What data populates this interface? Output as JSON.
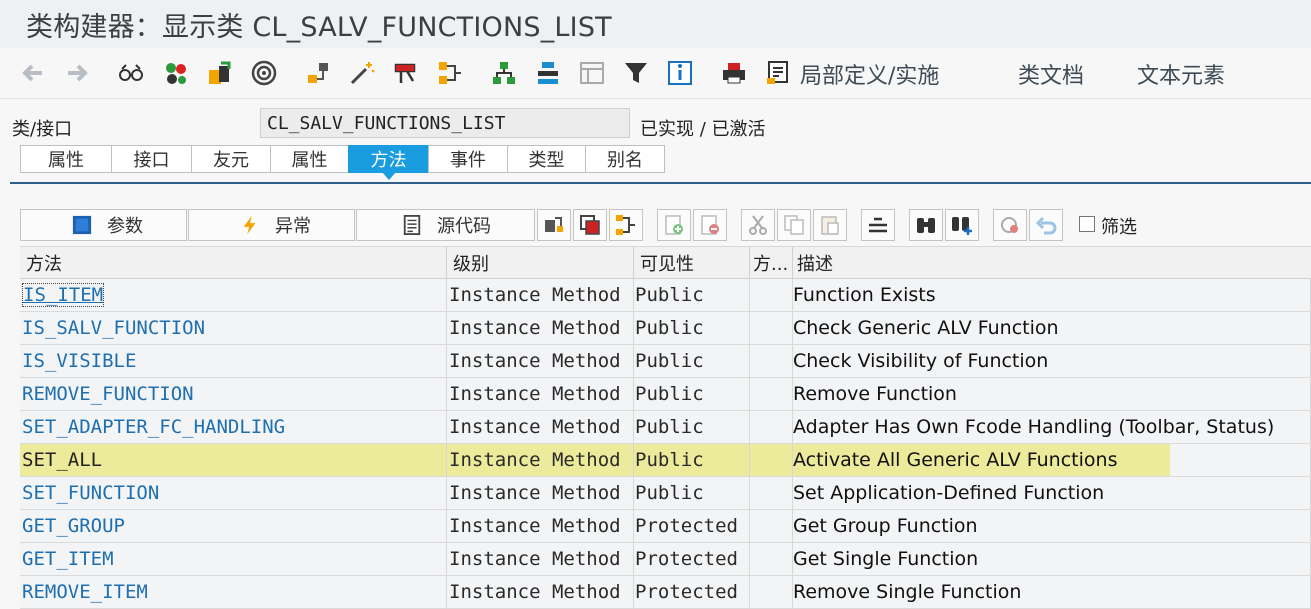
{
  "window": {
    "title": "类构建器：显示类 CL_SALV_FUNCTIONS_LIST"
  },
  "toolbar": {
    "icons": [
      "arrow-back-icon",
      "arrow-forward-icon",
      "glasses-icon",
      "object-list-icon",
      "transport-icon",
      "where-used-icon",
      "hierarchy-icon",
      "magic-wand-icon",
      "pattern-icon",
      "block-icon",
      "split-icon",
      "class-hierarchy-icon",
      "layout-icon",
      "table-icon",
      "filter-icon",
      "info-icon",
      "print-icon",
      "document-icon"
    ],
    "local_def": "局部定义/实施",
    "class_doc": "类文档",
    "text_elements": "文本元素"
  },
  "class_row": {
    "label": "类/接口",
    "value": "CL_SALV_FUNCTIONS_LIST",
    "status": "已实现 / 已激活"
  },
  "tabs": [
    {
      "label": "属性"
    },
    {
      "label": "接口"
    },
    {
      "label": "友元"
    },
    {
      "label": "属性"
    },
    {
      "label": "方法"
    },
    {
      "label": "事件"
    },
    {
      "label": "类型"
    },
    {
      "label": "别名"
    }
  ],
  "active_tab": "方法",
  "actions": {
    "params": "参数",
    "exceptions": "异常",
    "source": "源代码",
    "filter": "筛选"
  },
  "grid": {
    "headers": {
      "method": "方法",
      "level": "级别",
      "visibility": "可见性",
      "modeled": "方...",
      "description": "描述"
    },
    "rows": [
      {
        "method": "IS_ITEM",
        "level": "Instance Method",
        "visibility": "Public",
        "description": "Function Exists"
      },
      {
        "method": "IS_SALV_FUNCTION",
        "level": "Instance Method",
        "visibility": "Public",
        "description": "Check Generic ALV Function"
      },
      {
        "method": "IS_VISIBLE",
        "level": "Instance Method",
        "visibility": "Public",
        "description": "Check Visibility of Function"
      },
      {
        "method": "REMOVE_FUNCTION",
        "level": "Instance Method",
        "visibility": "Public",
        "description": "Remove Function"
      },
      {
        "method": "SET_ADAPTER_FC_HANDLING",
        "level": "Instance Method",
        "visibility": "Public",
        "description": "Adapter Has Own Fcode Handling (Toolbar, Status)"
      },
      {
        "method": "SET_ALL",
        "level": "Instance Method",
        "visibility": "Public",
        "description": "Activate All Generic ALV Functions"
      },
      {
        "method": "SET_FUNCTION",
        "level": "Instance Method",
        "visibility": "Public",
        "description": "Set Application-Defined Function"
      },
      {
        "method": "GET_GROUP",
        "level": "Instance Method",
        "visibility": "Protected",
        "description": "Get Group Function"
      },
      {
        "method": "GET_ITEM",
        "level": "Instance Method",
        "visibility": "Protected",
        "description": "Get Single Function"
      },
      {
        "method": "REMOVE_ITEM",
        "level": "Instance Method",
        "visibility": "Protected",
        "description": "Remove Single Function"
      }
    ],
    "highlight_color": "#ecea9b",
    "link_color": "#1e6fb0"
  }
}
